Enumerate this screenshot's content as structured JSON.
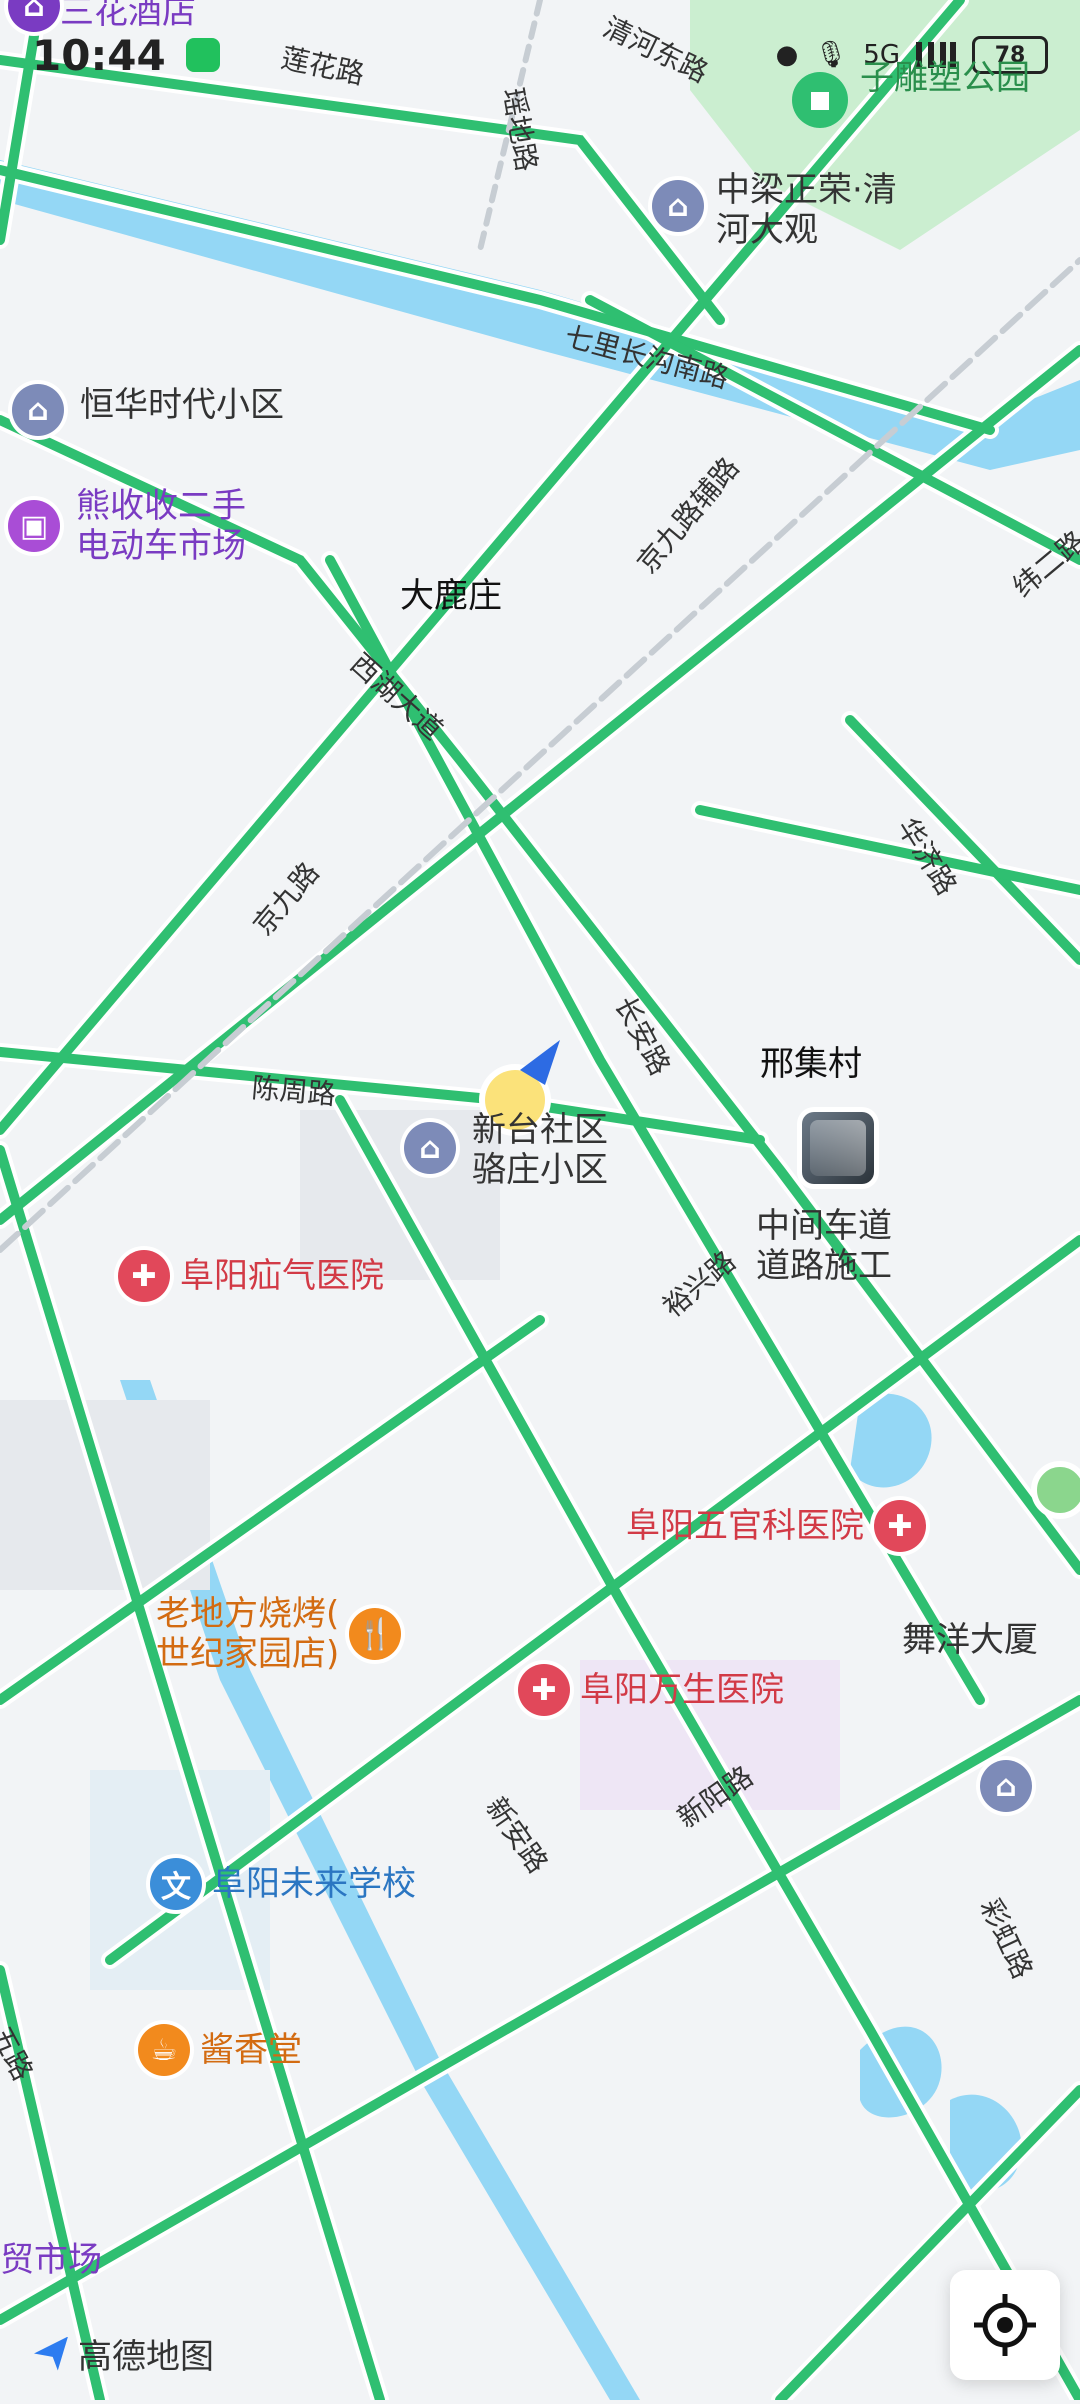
{
  "status_bar": {
    "time": "10:44",
    "network": "5G",
    "battery": "78"
  },
  "colors": {
    "road": "#2fbf71",
    "road_edge": "#ffffff",
    "water": "#94d7f5",
    "park": "#cbeed0",
    "background": "#f2f4f6",
    "poi_text_purple": "#7a3bc2",
    "poi_text_red": "#d23a46",
    "poi_text_orange": "#d36b11",
    "poi_text_blue": "#2b76c2"
  },
  "map": {
    "place_labels": {
      "dalu_zhuang": "大鹿庄",
      "xingjicun": "邢集村",
      "wuyang": "舞洋大厦",
      "sanhua": "三花酒店",
      "zhongliang": "中梁正荣·清\n河大观",
      "henghua": "恒华时代小区",
      "xiongshou": "熊收收二手\n电动车市场",
      "xintai": "新台社区\n骆庄小区",
      "zhongjian": "中间车道\n道路施工",
      "park": "子雕塑公园",
      "market": "贸市场"
    },
    "road_labels": {
      "lianhua": "莲花路",
      "yaodi": "瑶地路",
      "qinghe": "清河东路",
      "qili": "七里长沟南路",
      "jingjiu_fu": "京九路辅路",
      "xihu": "西湖大道",
      "jingjiu": "京九路",
      "chenzhou": "陈周路",
      "changan": "长安路",
      "yuxing": "裕兴路",
      "huaji": "华济路",
      "weier": "纬二路",
      "xinyang": "新阳路",
      "xinan": "新安路",
      "caishi": "彩虹路",
      "left": "五路"
    },
    "pois": {
      "shanqi": {
        "label": "阜阳疝气医院",
        "icon": "hospital-icon"
      },
      "wuguanke": {
        "label": "阜阳五官科医院",
        "icon": "hospital-icon"
      },
      "wansheng": {
        "label": "阜阳万生医院",
        "icon": "hospital-icon"
      },
      "laodifang": {
        "label": "老地方烧烤(\n世纪家园店)",
        "icon": "restaurant-icon"
      },
      "weilai": {
        "label": "阜阳未来学校",
        "icon": "school-icon"
      },
      "jiangxiang": {
        "label": "酱香堂",
        "icon": "food-icon"
      }
    },
    "brand": "高德地图"
  }
}
